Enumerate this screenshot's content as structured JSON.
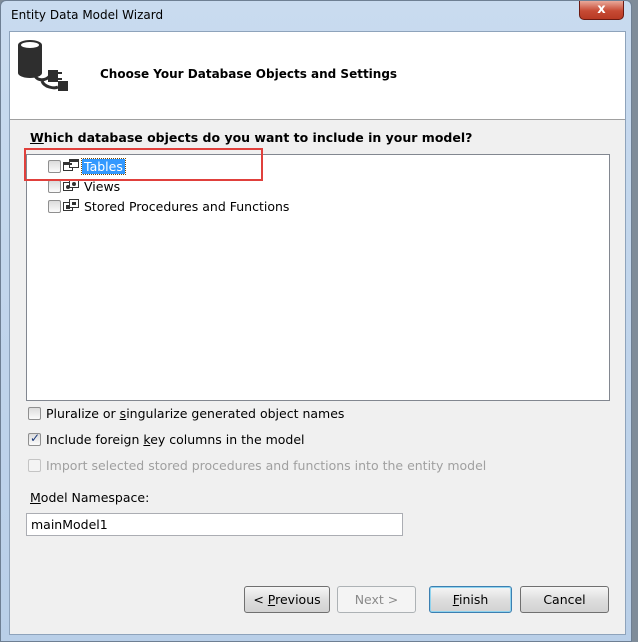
{
  "window": {
    "title": "Entity Data Model Wizard",
    "close_glyph": "x"
  },
  "header": {
    "title": "Choose Your Database Objects and Settings"
  },
  "main": {
    "question": "Which database objects do you want to include in your model?",
    "tree_items": [
      {
        "label": "Tables",
        "checked": false,
        "selected": true
      },
      {
        "label": "Views",
        "checked": false,
        "selected": false
      },
      {
        "label": "Stored Procedures and Functions",
        "checked": false,
        "selected": false
      }
    ],
    "options": [
      {
        "label": "Pluralize or singularize generated object names",
        "checked": false,
        "enabled": true
      },
      {
        "label": "Include foreign key columns in the model",
        "checked": true,
        "enabled": true
      },
      {
        "label": "Import selected stored procedures and functions into the entity model",
        "checked": false,
        "enabled": false
      }
    ],
    "namespace_label": "Model Namespace:",
    "namespace_value": "mainModel1"
  },
  "footer": {
    "previous_label": "< Previous",
    "next_label": "Next >",
    "finish_label": "Finish",
    "cancel_label": "Cancel"
  },
  "colors": {
    "selection": "#3399ff",
    "annotation_border": "#e0403c",
    "close_button": "#c74a34"
  }
}
